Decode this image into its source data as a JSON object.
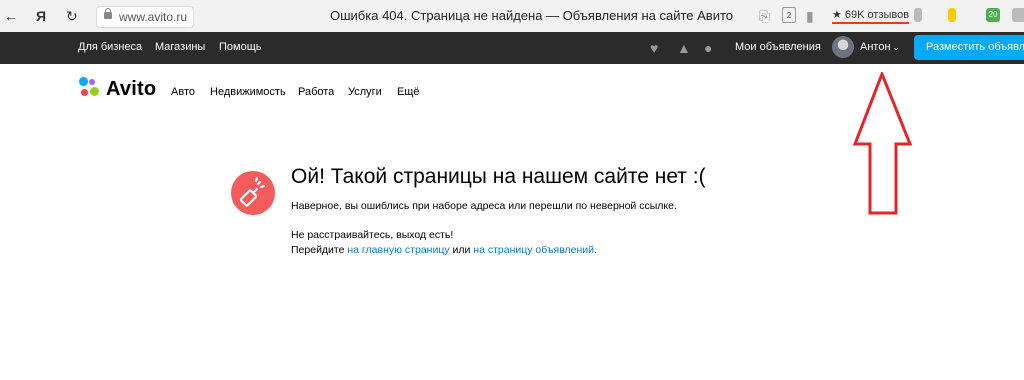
{
  "browser": {
    "url": "www.avito.ru",
    "tab_title": "Ошибка 404. Страница не найдена — Объявления на сайте Авито",
    "reviews": "★ 69K отзывов",
    "badge_count": "2",
    "ext_count": "20",
    "back_icon": "back-arrow-icon",
    "reload_icon": "reload-icon"
  },
  "topnav": {
    "business": "Для бизнеса",
    "shops": "Магазины",
    "help": "Помощь",
    "my_ads": "Мои объявления",
    "user_name": "Антон",
    "post_button": "Разместить объявление",
    "bg_color": "#2b2b2b",
    "button_color": "#00aaff"
  },
  "brand": {
    "name": "Avito"
  },
  "categories": [
    "Авто",
    "Недвижимость",
    "Работа",
    "Услуги",
    "Ещё"
  ],
  "error": {
    "title": "Ой! Такой страницы на нашем сайте нет :(",
    "line1": "Наверное, вы ошиблись при наборе адреса или перешли по неверной ссылке.",
    "line2": "Не расстраивайтесь, выход есть!",
    "line3_prefix": "Перейдите ",
    "link_main": "на главную страницу",
    "line3_mid": " или ",
    "link_ads": "на страницу объявлений.",
    "icon_color": "#f45c5c",
    "link_color": "#0a7ec2"
  }
}
